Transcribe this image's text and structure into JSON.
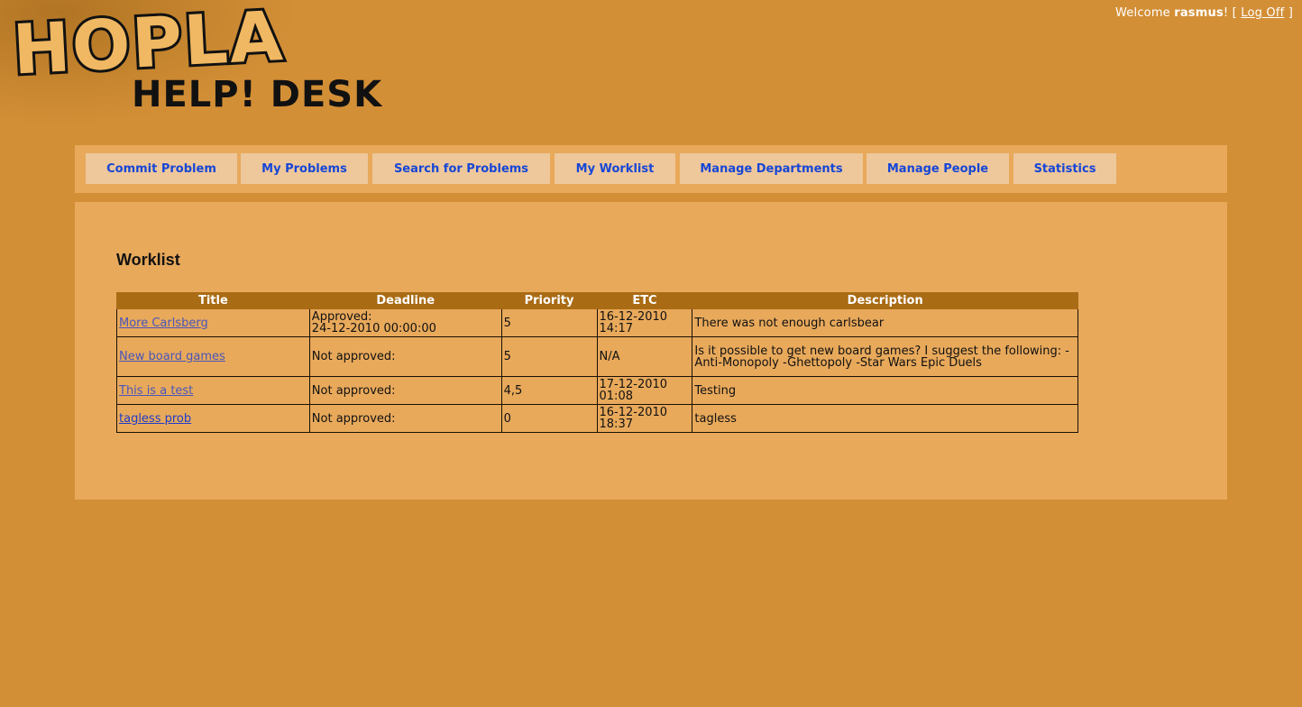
{
  "header": {
    "logo_line1": "HOPLA",
    "logo_line2": "HELP! DESK",
    "welcome_prefix": "Welcome ",
    "username": "rasmus",
    "welcome_suffix": "! [ ",
    "logoff_label": "Log Off",
    "bracket_close": " ]"
  },
  "nav": {
    "items": [
      {
        "label": "Commit Problem"
      },
      {
        "label": "My Problems"
      },
      {
        "label": "Search for Problems"
      },
      {
        "label": "My Worklist"
      },
      {
        "label": "Manage Departments"
      },
      {
        "label": "Manage People"
      },
      {
        "label": "Statistics"
      }
    ]
  },
  "main": {
    "title": "Worklist",
    "columns": [
      "Title",
      "Deadline",
      "Priority",
      "ETC",
      "Description"
    ],
    "rows": [
      {
        "title": "More Carlsberg",
        "deadline_status": "Approved:",
        "deadline_date": "24-12-2010 00:00:00",
        "priority": "5",
        "etc_date": "16-12-2010",
        "etc_time": "14:17",
        "description": "There was not enough carlsbear"
      },
      {
        "title": "New board games",
        "deadline_status": "Not approved:",
        "deadline_date": "",
        "priority": "5",
        "etc_date": "N/A",
        "etc_time": "",
        "description": "Is it possible to get new board games? I suggest the following: -Anti-Monopoly -Ghettopoly -Star Wars Epic Duels"
      },
      {
        "title": "This is a test",
        "deadline_status": "Not approved:",
        "deadline_date": "",
        "priority": "4,5",
        "etc_date": "17-12-2010",
        "etc_time": "01:08",
        "description": "Testing"
      },
      {
        "title": "tagless prob",
        "deadline_status": "Not approved:",
        "deadline_date": "",
        "priority": "0",
        "etc_date": "16-12-2010",
        "etc_time": "18:37",
        "description": "tagless"
      }
    ]
  },
  "colors": {
    "background": "#d38f36",
    "panel": "#e8a95b",
    "nav_button": "#eec79b",
    "nav_text": "#1646d6",
    "table_header": "#a96b14"
  }
}
